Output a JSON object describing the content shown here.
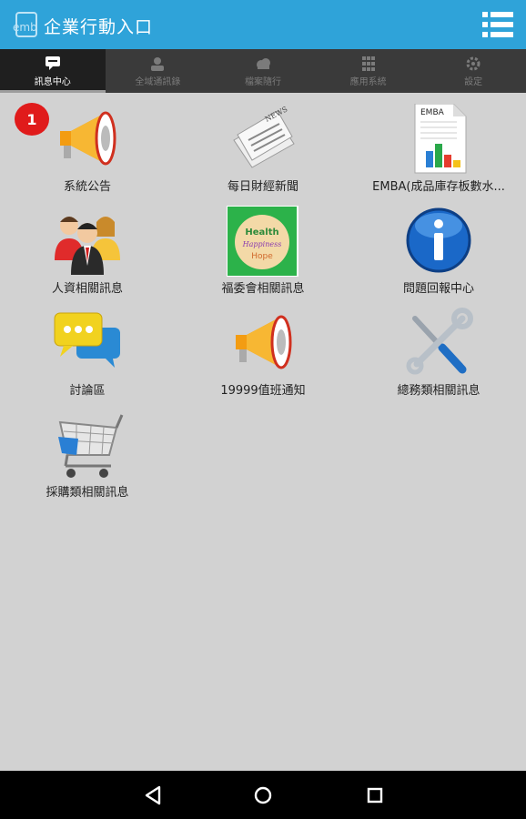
{
  "app": {
    "title": "企業行動入口",
    "logo_text": "emb"
  },
  "tabs": [
    {
      "label": "訊息中心",
      "icon": "chat-icon",
      "active": true
    },
    {
      "label": "全域通訊錄",
      "icon": "contact-icon",
      "active": false
    },
    {
      "label": "檔案隨行",
      "icon": "cloud-icon",
      "active": false
    },
    {
      "label": "應用系統",
      "icon": "apps-grid-icon",
      "active": false
    },
    {
      "label": "設定",
      "icon": "gear-icon",
      "active": false
    }
  ],
  "badge": {
    "count": "1"
  },
  "items": [
    {
      "label": "系統公告",
      "icon": "megaphone-icon"
    },
    {
      "label": "每日財經新聞",
      "icon": "newspaper-icon"
    },
    {
      "label": "EMBA(成品庫存板數水...",
      "icon": "emba-chart-document-icon"
    },
    {
      "label": "人資相關訊息",
      "icon": "people-icon"
    },
    {
      "label": "福委會相關訊息",
      "icon": "health-happiness-hope-icon",
      "icon_text": [
        "Health",
        "Happiness",
        "Hope"
      ]
    },
    {
      "label": "問題回報中心",
      "icon": "info-icon"
    },
    {
      "label": "討論區",
      "icon": "chat-bubbles-icon"
    },
    {
      "label": "19999值班通知",
      "icon": "megaphone-icon"
    },
    {
      "label": "總務類相關訊息",
      "icon": "tools-icon"
    },
    {
      "label": "採購類相關訊息",
      "icon": "shopping-cart-icon"
    }
  ],
  "colors": {
    "appbar": "#2fa3d9",
    "tabbar": "#3a3a3a",
    "background": "#d2d2d2",
    "badge": "#e01b1b"
  }
}
